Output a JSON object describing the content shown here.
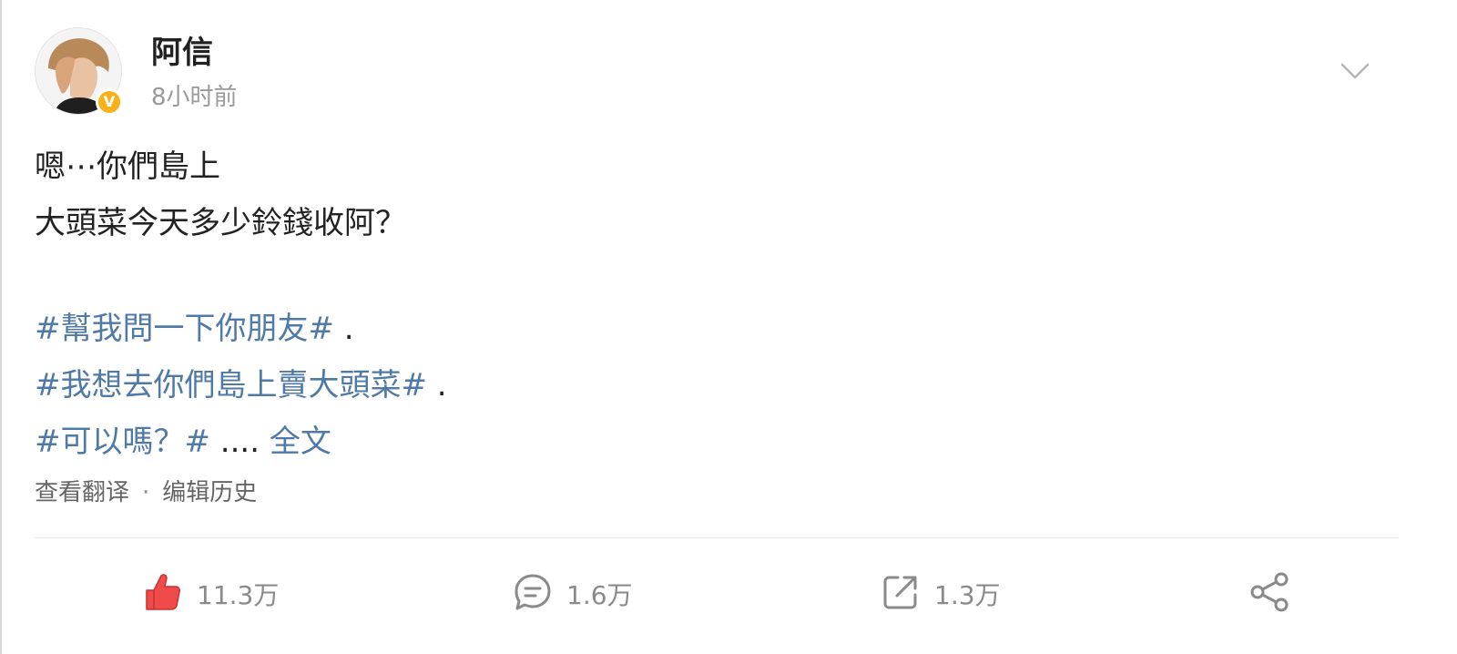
{
  "post": {
    "author": "阿信",
    "time": "8小时前",
    "verified_badge": "V",
    "line1": "嗯⋯你們島上",
    "line2": "大頭菜今天多少鈴錢收阿？",
    "tag1": "#幫我問一下你朋友#",
    "tag1_suffix": " .",
    "tag2": "#我想去你們島上賣大頭菜#",
    "tag2_suffix": " .",
    "tag3": "#可以嗎？#",
    "tag3_suffix": " .... ",
    "more_label": "全文"
  },
  "meta": {
    "translate_label": "查看翻译",
    "separator": "·",
    "edit_history_label": "编辑历史"
  },
  "actions": {
    "like_count": "11.3万",
    "comment_count": "1.6万",
    "repost_count": "1.3万"
  },
  "colors": {
    "link": "#4f7aa8",
    "like_red": "#f04b4b",
    "badge_gold": "#f5b21b"
  },
  "icons": {
    "more": "chevron-down-icon",
    "like": "thumbs-up-icon",
    "comment": "comment-icon",
    "repost": "repost-icon",
    "share": "share-icon"
  }
}
